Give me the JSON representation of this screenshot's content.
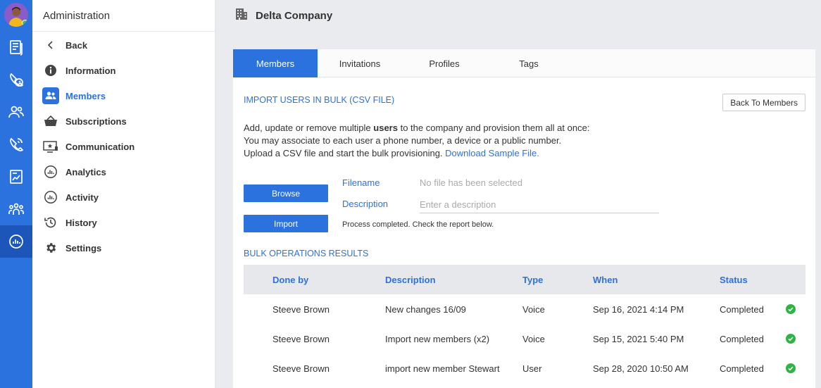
{
  "sidebar": {
    "title": "Administration",
    "items": [
      {
        "label": "Back",
        "icon": "chevron-left-icon"
      },
      {
        "label": "Information",
        "icon": "info-icon"
      },
      {
        "label": "Members",
        "icon": "users-icon",
        "active": true
      },
      {
        "label": "Subscriptions",
        "icon": "basket-icon"
      },
      {
        "label": "Communication",
        "icon": "monitor-star-icon"
      },
      {
        "label": "Analytics",
        "icon": "analytics-icon"
      },
      {
        "label": "Activity",
        "icon": "activity-icon"
      },
      {
        "label": "History",
        "icon": "history-icon"
      },
      {
        "label": "Settings",
        "icon": "gear-icon"
      }
    ]
  },
  "rail": {
    "icons": [
      "avatar",
      "document-icon",
      "phone-speed-icon",
      "people-icon",
      "phone-call-icon",
      "report-icon",
      "group-icon",
      "analytics-icon"
    ],
    "active": "analytics-icon"
  },
  "header": {
    "company": "Delta Company",
    "icon": "building-icon"
  },
  "tabs": [
    {
      "label": "Members",
      "active": true
    },
    {
      "label": "Invitations"
    },
    {
      "label": "Profiles"
    },
    {
      "label": "Tags"
    }
  ],
  "import": {
    "title": "IMPORT USERS IN BULK (CSV FILE)",
    "back_button": "Back To Members",
    "line1_prefix": "Add, update or remove multiple ",
    "line1_bold": "users",
    "line1_suffix": " to the company and provision them all at once:",
    "line2": "You may associate to each user a phone number, a device or a public number.",
    "line3_prefix": "Upload a CSV file and start the bulk provisioning. ",
    "line3_link": "Download Sample File.",
    "browse_button": "Browse",
    "import_button": "Import",
    "filename_label": "Filename",
    "filename_value": "No file has been selected",
    "description_label": "Description",
    "description_placeholder": "Enter a description",
    "status_message": "Process completed. Check the report below."
  },
  "results": {
    "title": "BULK OPERATIONS RESULTS",
    "columns": [
      "Done by",
      "Description",
      "Type",
      "When",
      "Status"
    ],
    "rows": [
      {
        "done_by": "Steeve Brown",
        "description": "New changes 16/09",
        "type": "Voice",
        "when": "Sep 16, 2021 4:14 PM",
        "status": "Completed"
      },
      {
        "done_by": "Steeve Brown",
        "description": "Import new members (x2)",
        "type": "Voice",
        "when": "Sep 15, 2021 5:40 PM",
        "status": "Completed"
      },
      {
        "done_by": "Steeve Brown",
        "description": "import new member Stewart",
        "type": "User",
        "when": "Sep 28, 2020 10:50 AM",
        "status": "Completed"
      }
    ]
  },
  "colors": {
    "accent": "#2b72de",
    "rail": "#2b72de",
    "success": "#2fb344"
  }
}
